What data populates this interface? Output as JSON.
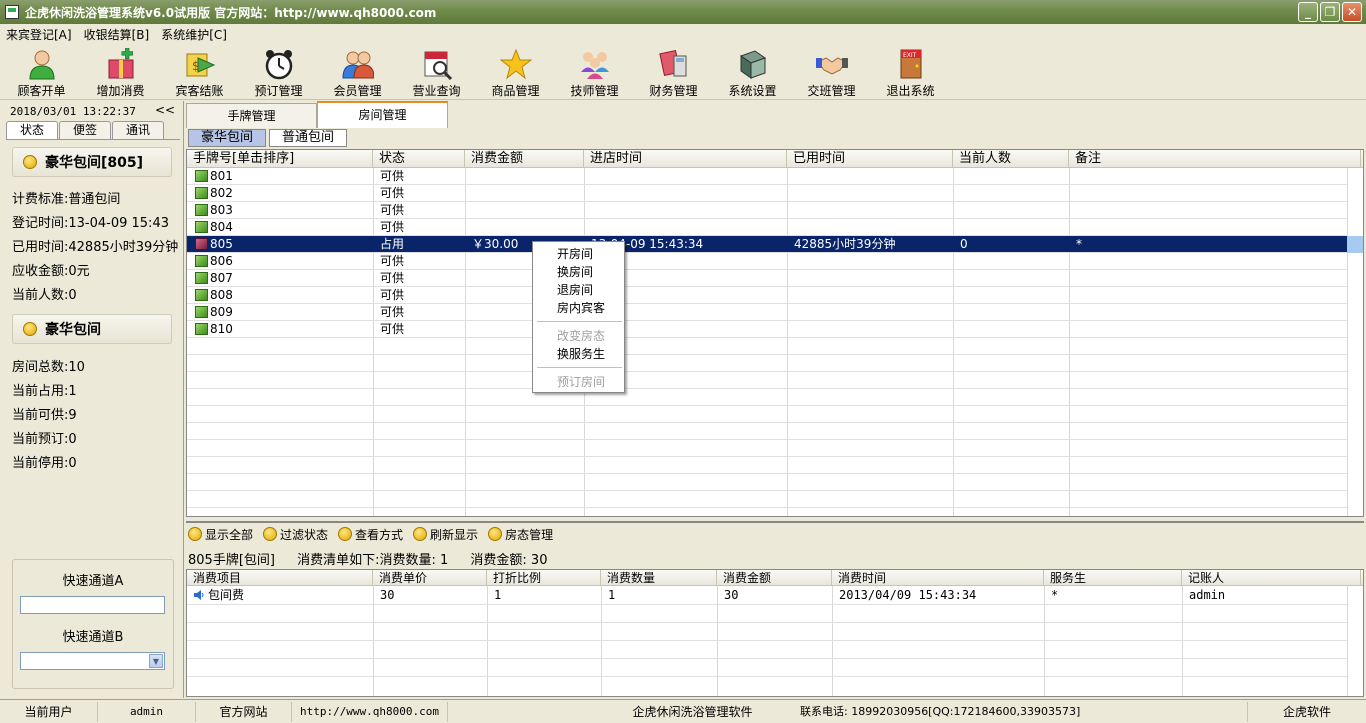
{
  "window": {
    "title": "企虎休闲洗浴管理系统v6.0试用版  官方网站：http://www.qh8000.com",
    "min": "_",
    "max": "❐",
    "close": "✕"
  },
  "menu": [
    "来宾登记[A]",
    "收银结算[B]",
    "系统维护[C]"
  ],
  "toolbar": [
    {
      "label": "顾客开单",
      "icon": "customer-icon"
    },
    {
      "label": "增加消费",
      "icon": "add-gift-icon"
    },
    {
      "label": "宾客结账",
      "icon": "checkout-icon"
    },
    {
      "label": "预订管理",
      "icon": "alarm-clock-icon"
    },
    {
      "label": "会员管理",
      "icon": "members-icon"
    },
    {
      "label": "营业查询",
      "icon": "calendar-search-icon"
    },
    {
      "label": "商品管理",
      "icon": "star-icon"
    },
    {
      "label": "技师管理",
      "icon": "technicians-icon"
    },
    {
      "label": "财务管理",
      "icon": "finance-icon"
    },
    {
      "label": "系统设置",
      "icon": "settings-book-icon"
    },
    {
      "label": "交班管理",
      "icon": "handshake-icon"
    },
    {
      "label": "退出系统",
      "icon": "exit-door-icon"
    }
  ],
  "left": {
    "datetime": "2018/03/01 13:22:37",
    "collapse": "<<",
    "tabs": [
      "状态",
      "便签",
      "通讯"
    ],
    "room_group_title": "豪华包间[805]",
    "room_info": [
      "计费标准:普通包间",
      "登记时间:13-04-09 15:43",
      "已用时间:42885小时39分钟",
      "应收金额:0元",
      "当前人数:0"
    ],
    "category_title": "豪华包间",
    "category_info": [
      "房间总数:10",
      "当前占用:1",
      "当前可供:9",
      "当前预订:0",
      "当前停用:0"
    ],
    "quick_a_label": "快速通道A",
    "quick_b_label": "快速通道B"
  },
  "main": {
    "tabs": [
      "手牌管理",
      "房间管理"
    ],
    "subtabs": [
      "豪华包间",
      "普通包间"
    ],
    "columns": [
      "手牌号[单击排序]",
      "状态",
      "消费金额",
      "进店时间",
      "已用时间",
      "当前人数",
      "备注"
    ],
    "rooms": [
      {
        "no": "801",
        "status": "可供"
      },
      {
        "no": "802",
        "status": "可供"
      },
      {
        "no": "803",
        "status": "可供"
      },
      {
        "no": "804",
        "status": "可供"
      },
      {
        "no": "805",
        "status": "占用",
        "amount": "￥30.00",
        "in_time": "13-04-09 15:43:34",
        "used": "42885小时39分钟",
        "people": "0",
        "note": "*",
        "selected": true
      },
      {
        "no": "806",
        "status": "可供"
      },
      {
        "no": "807",
        "status": "可供"
      },
      {
        "no": "808",
        "status": "可供"
      },
      {
        "no": "809",
        "status": "可供"
      },
      {
        "no": "810",
        "status": "可供"
      }
    ],
    "context_menu": [
      {
        "label": "开房间",
        "enabled": true
      },
      {
        "label": "换房间",
        "enabled": true
      },
      {
        "label": "退房间",
        "enabled": true
      },
      {
        "label": "房内宾客",
        "enabled": true
      },
      {
        "label": "改变房态",
        "enabled": false
      },
      {
        "label": "换服务生",
        "enabled": true
      },
      {
        "label": "预订房间",
        "enabled": false
      }
    ],
    "actions": [
      "显示全部",
      "过滤状态",
      "查看方式",
      "刷新显示",
      "房态管理"
    ],
    "summary": [
      "805手牌[包间]",
      "消费清单如下:消费数量: 1",
      "消费金额: 30"
    ],
    "detail_columns": [
      "消费项目",
      "消费单价",
      "打折比例",
      "消费数量",
      "消费金额",
      "消费时间",
      "服务生",
      "记账人"
    ],
    "detail_rows": [
      [
        "包间费",
        "30",
        "1",
        "1",
        "30",
        "2013/04/09 15:43:34",
        "*",
        "admin"
      ]
    ]
  },
  "status": {
    "user_label": "当前用户",
    "user": "admin",
    "site_label": "官方网站",
    "site": "http://www.qh8000.com",
    "software": "企虎休闲洗浴管理软件",
    "contact": "联系电话: 18992030956[QQ:172184600,33903573]",
    "brand": "企虎软件"
  },
  "colors": {
    "selection": "#0a246a",
    "titlebar": "#6f8a4a",
    "tab_accent": "#e68b2c"
  }
}
